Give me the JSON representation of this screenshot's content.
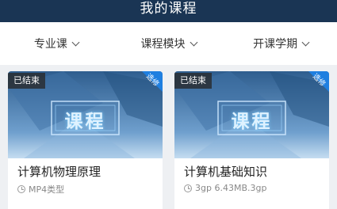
{
  "header": {
    "title": "我的课程"
  },
  "filters": [
    {
      "label": "专业课"
    },
    {
      "label": "课程模块"
    },
    {
      "label": "开课学期"
    }
  ],
  "cards": [
    {
      "status": "已结束",
      "ribbon": "选修",
      "cover_text": "课程",
      "title": "计算机物理原理",
      "meta": "MP4类型",
      "meta_icon": "clock-icon"
    },
    {
      "status": "已结束",
      "ribbon": "选修",
      "cover_text": "课程",
      "title": "计算机基础知识",
      "meta": "3gp 6.43MB.3gp",
      "meta_icon": "clock-icon"
    }
  ],
  "colors": {
    "header_bg": "#1a3554",
    "ribbon": "#1f7fe0",
    "cover_dark": "#3a6fa0",
    "cover_light": "#a9c9e6"
  }
}
